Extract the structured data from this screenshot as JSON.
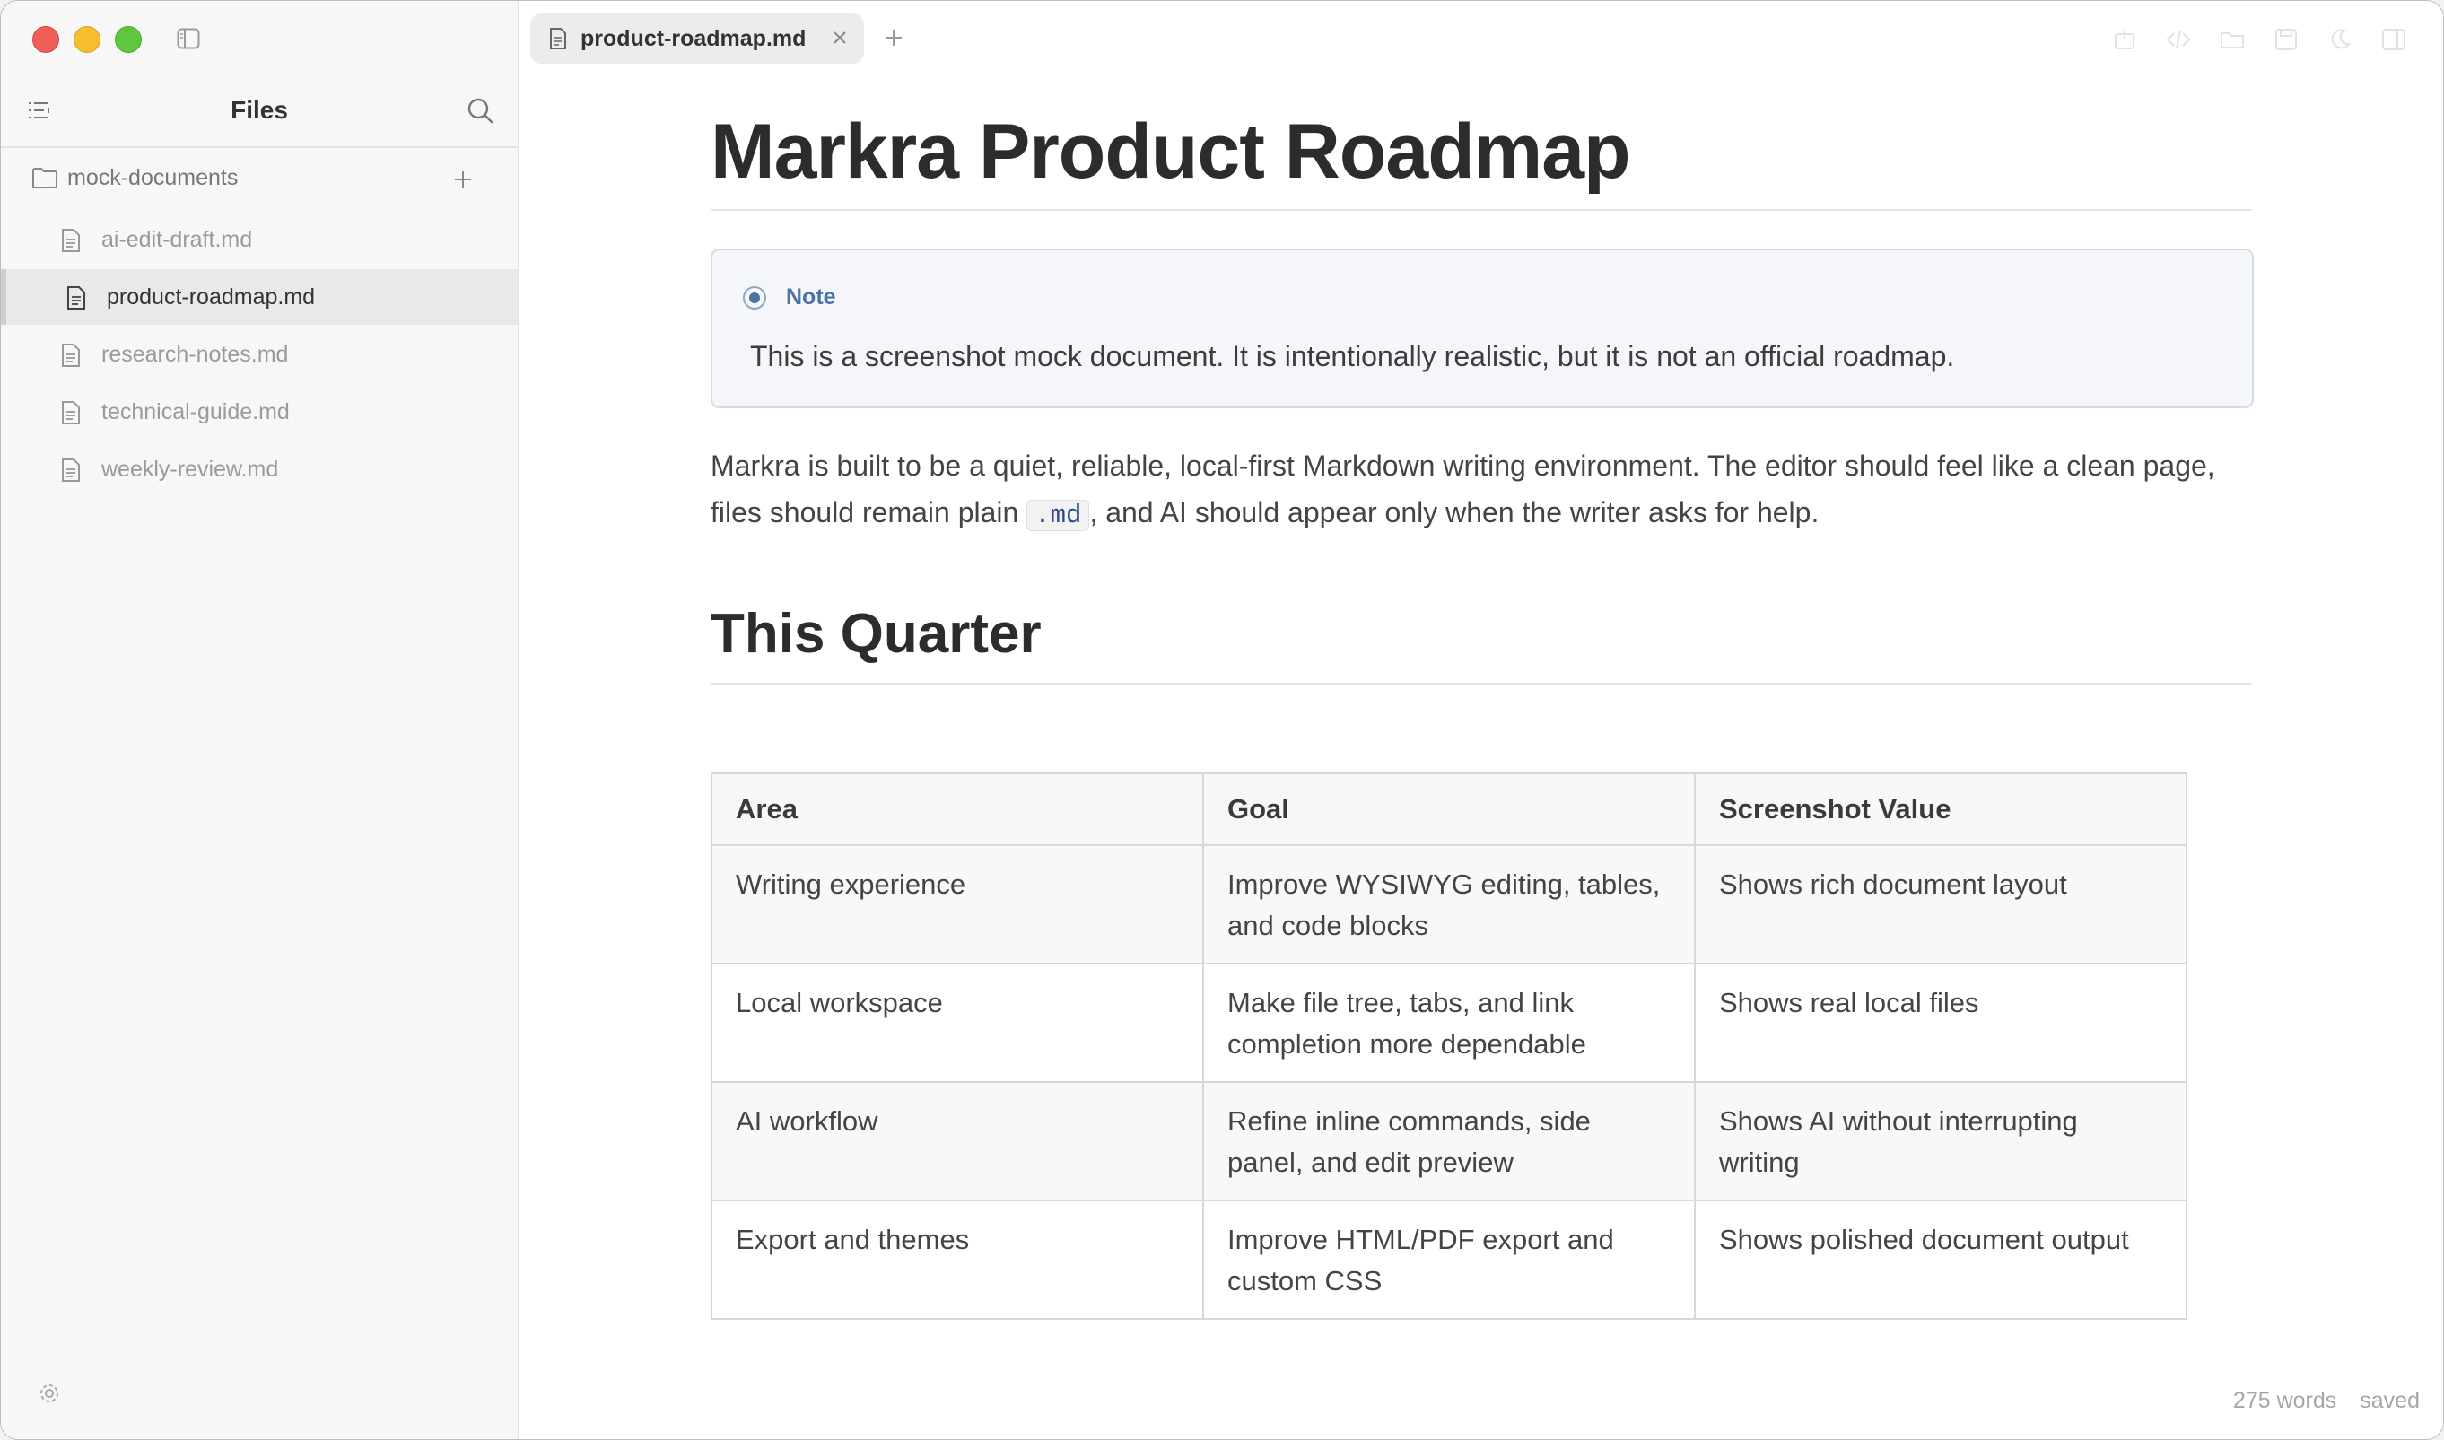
{
  "sidebar": {
    "title": "Files",
    "folder": "mock-documents",
    "files": [
      {
        "label": "ai-edit-draft.md",
        "active": false
      },
      {
        "label": "product-roadmap.md",
        "active": true
      },
      {
        "label": "research-notes.md",
        "active": false
      },
      {
        "label": "technical-guide.md",
        "active": false
      },
      {
        "label": "weekly-review.md",
        "active": false
      }
    ]
  },
  "tabs": [
    {
      "label": "product-roadmap.md",
      "active": true
    }
  ],
  "document": {
    "h1": "Markra Product Roadmap",
    "note": {
      "title": "Note",
      "body": "This is a screenshot mock document. It is intentionally realistic, but it is not an official roadmap."
    },
    "paragraph_before": "Markra is built to be a quiet, reliable, local-first Markdown writing environment. The editor should feel like a clean page, files should remain plain ",
    "paragraph_code": ".md",
    "paragraph_after": ", and AI should appear only when the writer asks for help.",
    "h2": "This Quarter",
    "table": {
      "headers": [
        "Area",
        "Goal",
        "Screenshot Value"
      ],
      "rows": [
        [
          "Writing experience",
          "Improve WYSIWYG editing, tables, and code blocks",
          "Shows rich document layout"
        ],
        [
          "Local workspace",
          "Make file tree, tabs, and link completion more dependable",
          "Shows real local files"
        ],
        [
          "AI workflow",
          "Refine inline commands, side panel, and edit preview",
          "Shows AI without interrupting writing"
        ],
        [
          "Export and themes",
          "Improve HTML/PDF export and custom CSS",
          "Shows polished document output"
        ]
      ]
    }
  },
  "status": {
    "words": "275 words",
    "save_state": "saved"
  },
  "icons": {
    "toolbar": [
      "export-icon",
      "source-code-icon",
      "open-folder-icon",
      "save-icon",
      "theme-moon-icon",
      "right-panel-icon"
    ]
  },
  "colors": {
    "note_accent": "#4a72a6",
    "close": "#ee5f57",
    "minimize": "#f5bd2f",
    "maximize": "#5fc73f"
  }
}
